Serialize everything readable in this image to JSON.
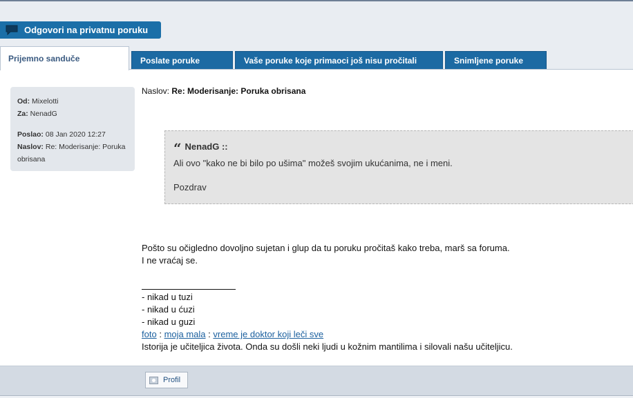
{
  "reply_button": {
    "label": "Odgovori na privatnu poruku",
    "icon": "speech-bubble-icon"
  },
  "tabs": [
    {
      "label": "Prijemno sanduče",
      "active": true
    },
    {
      "label": "Poslate poruke",
      "active": false
    },
    {
      "label": "Vaše poruke koje primaoci još nisu pročitali",
      "active": false
    },
    {
      "label": "Snimljene poruke",
      "active": false
    }
  ],
  "info": {
    "from_label": "Od:",
    "from_value": "Mixelotti",
    "to_label": "Za:",
    "to_value": "NenadG",
    "sent_label": "Poslao:",
    "sent_value": "08 Jan 2020 12:27",
    "subject_label": "Naslov:",
    "subject_value": "Re: Moderisanje: Poruka obrisana"
  },
  "subject": {
    "label": "Naslov:",
    "value": "Re: Moderisanje: Poruka obrisana"
  },
  "quote": {
    "author": "NenadG ::",
    "line1": "Ali ovo \"kako ne bi bilo po ušima\" možeš svojim ukućanima, ne i meni.",
    "line2": "Pozdrav"
  },
  "message": {
    "line1": "Pošto su očigledno dovoljno sujetan i glup da tu poruku pročitaš kako treba, marš sa foruma.",
    "line2": "I ne vraćaj se."
  },
  "signature": {
    "lines": [
      "- nikad u tuzi",
      "- nikad u ćuzi",
      "- nikad u guzi"
    ],
    "links": [
      "foto",
      "moja mala",
      "vreme je doktor koji leči sve"
    ],
    "separator": ":",
    "motto": "Istorija je učiteljica života. Onda su došli neki ljudi u kožnim mantilima i silovali našu učiteljicu."
  },
  "footer": {
    "profile_label": "Profil",
    "profile_icon": "profile-icon"
  },
  "colors": {
    "accent": "#1c6aa3",
    "tab_active_text": "#3a5a80",
    "link": "#1a5f9e"
  }
}
